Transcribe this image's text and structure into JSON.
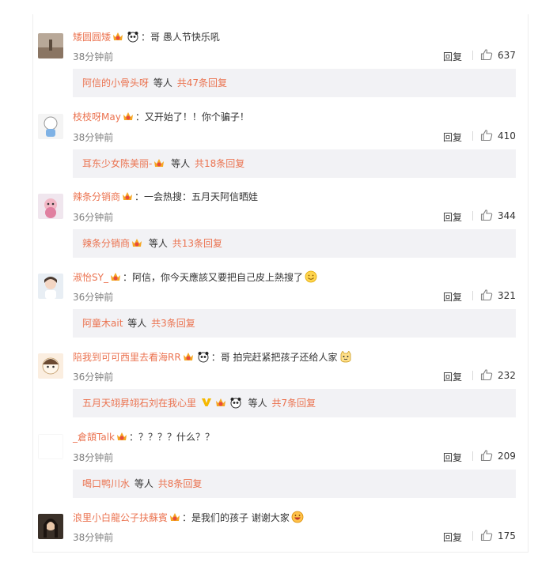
{
  "colors": {
    "accent": "#eb7350",
    "text": "#333333",
    "meta": "#808080",
    "reply_bg": "#f2f2f5"
  },
  "labels": {
    "reply": "回复",
    "etc": "等人"
  },
  "comments": [
    {
      "user": "矮圆圆矮",
      "text": "哥 愚人节快乐吼",
      "text_suffix_emoji": "",
      "time": "38分钟前",
      "likes": "637",
      "reply_names": "阿信的小骨头呀",
      "reply_total": "共47条回复",
      "reply_suffix_icon": ""
    },
    {
      "user": "枝枝呀May",
      "text": "又开始了！！你个骗子！",
      "text_suffix_emoji": "",
      "time": "38分钟前",
      "likes": "410",
      "reply_names": "耳东少女陈美丽-",
      "reply_total": "共18条回复",
      "reply_suffix_icon": ""
    },
    {
      "user": "辣条分销商",
      "text": "一会热搜：五月天阿信晒娃",
      "text_suffix_emoji": "",
      "time": "36分钟前",
      "likes": "344",
      "reply_names": "辣条分销商",
      "reply_total": "共13条回复",
      "reply_suffix_icon": ""
    },
    {
      "user": "淑怡SY_",
      "text": "阿信，你今天應該又要把自己皮上熱搜了",
      "text_suffix_emoji": "smile-emoji",
      "time": "36分钟前",
      "likes": "321",
      "reply_names": "阿童木ait",
      "reply_total": "共3条回复",
      "reply_suffix_icon": ""
    },
    {
      "user": "陪我到可可西里去看海RR",
      "text": "哥 拍完赶紧把孩子还给人家",
      "text_suffix_emoji": "cat-emoji",
      "time": "36分钟前",
      "likes": "232",
      "reply_names": "五月天翊昇翊石刘在我心里",
      "reply_total": "共7条回复",
      "reply_suffix_icon": "v-icon"
    },
    {
      "user": "_倉頡Talk",
      "text": "？？？？什么？？",
      "text_suffix_emoji": "",
      "time": "38分钟前",
      "likes": "209",
      "reply_names": "喝口鸭川水",
      "reply_total": "共8条回复",
      "reply_suffix_icon": ""
    },
    {
      "user": "浪里小白龍公子扶蘇賓",
      "text": "是我们的孩子 谢谢大家",
      "text_suffix_emoji": "grin-emoji",
      "time": "38分钟前",
      "likes": "175",
      "reply_names": "",
      "reply_total": "",
      "reply_suffix_icon": ""
    }
  ]
}
